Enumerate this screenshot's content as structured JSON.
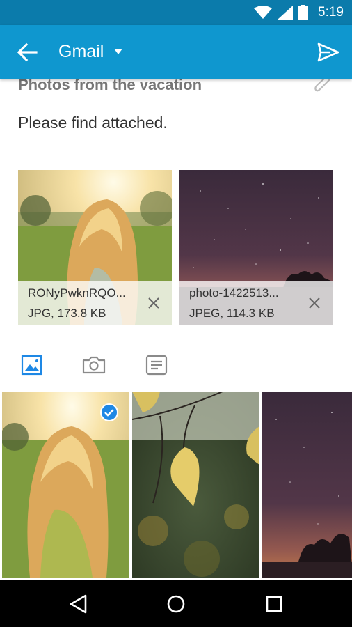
{
  "status_bar": {
    "time": "5:19",
    "icons": [
      "wifi-icon",
      "signal-icon",
      "battery-icon"
    ]
  },
  "app_bar": {
    "account": "Gmail",
    "back_icon": "arrow-back-icon",
    "dropdown_icon": "dropdown-arrow-icon",
    "send_icon": "send-icon",
    "color": "#0f97cf"
  },
  "compose": {
    "subject": "Photos from the vacation",
    "body": "Please find attached.",
    "attach_icon": "paperclip-icon"
  },
  "attachments": [
    {
      "name": "RONyPwknRQO...",
      "meta": "JPG, 173.8 KB",
      "thumb": "girl-sunlight"
    },
    {
      "name": "photo-1422513...",
      "meta": "JPEG, 114.3 KB",
      "thumb": "night-sky"
    }
  ],
  "picker": {
    "tabs": [
      {
        "name": "gallery",
        "icon": "image-icon",
        "active": true
      },
      {
        "name": "camera",
        "icon": "camera-icon",
        "active": false
      },
      {
        "name": "documents",
        "icon": "document-icon",
        "active": false
      }
    ],
    "photos": [
      {
        "thumb": "girl-sunlight",
        "selected": true
      },
      {
        "thumb": "autumn-leaves",
        "selected": false
      },
      {
        "thumb": "night-sky",
        "selected": false
      }
    ],
    "accent": "#1e88e5"
  },
  "nav_bar": {
    "buttons": [
      "back-triangle-icon",
      "home-circle-icon",
      "recents-square-icon"
    ]
  }
}
